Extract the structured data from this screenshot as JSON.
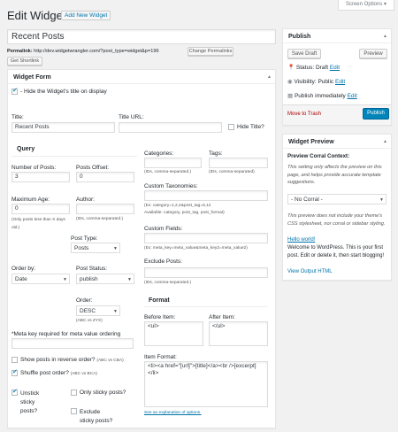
{
  "page": {
    "title": "Edit Widget",
    "add_new": "Add New Widget",
    "screen_options": "Screen Options",
    "post_title": "Recent Posts",
    "permalink_label": "Permalink:",
    "permalink_url": "http://dev.widgetwrangler.com/?post_type=widget&p=196",
    "change_permalinks": "Change Permalinks",
    "get_shortlink": "Get Shortlink"
  },
  "form": {
    "header": "Widget Form",
    "hide_title_label": "- Hide the Widget's title on display",
    "title_label": "Title:",
    "title_value": "Recent Posts",
    "title_url_label": "Title URL:",
    "title_url_value": "",
    "hide_title_q": "Hide Title?",
    "query_header": "Query",
    "num_posts_label": "Number of Posts:",
    "num_posts_value": "3",
    "offset_label": "Posts Offset:",
    "offset_value": "0",
    "max_age_label": "Maximum Age:",
    "max_age_value": "0",
    "max_age_help": "(Only posts less than X days old.)",
    "author_label": "Author:",
    "author_value": "",
    "author_help": "(IDs, comma-separated.)",
    "post_type_label": "Post Type:",
    "post_type_value": "Posts",
    "order_by_label": "Order by:",
    "order_by_value": "Date",
    "post_status_label": "Post Status:",
    "post_status_value": "publish",
    "order_label": "Order:",
    "order_value": "DESC",
    "order_help": "(ABC vs ZYX)",
    "meta_key_label": "*Meta key required for meta value ordering",
    "meta_key_value": "",
    "reverse_label": "Show posts in reverse order?",
    "reverse_help": "(ABC vs CBA)",
    "shuffle_label": "Shuffle post order?",
    "shuffle_help": "(ABC vs BCA)",
    "unstick_label": "Unstick sticky posts?",
    "only_sticky_label": "Only sticky posts?",
    "exclude_sticky_label": "Exclude sticky posts?",
    "categories_label": "Categories:",
    "categories_help": "(IDs, comma-separated.)",
    "tags_label": "Tags:",
    "tags_help": "(IDs, comma-separated)",
    "custom_tax_label": "Custom Taxonomies:",
    "custom_tax_help": "(Ex: category=1,2,4&post_tag=6,12",
    "custom_tax_avail": "Available: category, post_tag, post_format)",
    "custom_fields_label": "Custom Fields:",
    "custom_fields_help": "(Ex: meta_key=meta_value&meta_key2=meta_value2)",
    "exclude_posts_label": "Exclude Posts:",
    "exclude_posts_help": "(IDs, comma-separated.)",
    "format_header": "Format",
    "before_item_label": "Before Item:",
    "before_item_value": "<ul>",
    "after_item_label": "After Item:",
    "after_item_value": "</ul>",
    "item_format_label": "Item Format:",
    "item_format_value": "<li><a href=\"[url]\">[title]</a><br />[excerpt]</li>",
    "see_options": "See an explanation of options."
  },
  "publish": {
    "header": "Publish",
    "save_draft": "Save Draft",
    "preview": "Preview",
    "status_label": "Status: Draft",
    "visibility_label": "Visibility: Public",
    "publish_time": "Publish immediately",
    "edit": "Edit",
    "trash": "Move to Trash",
    "publish_button": "Publish",
    "accent": "#0085ba"
  },
  "preview": {
    "header": "Widget Preview",
    "context_label": "Preview Corral Context:",
    "context_help": "This setting only affects the preview on this page, and helps provide accurate template suggestions.",
    "select_value": "- No Corral -",
    "note": "This preview does not include your theme's CSS stylesheet, nor corral or sidebar styling.",
    "hello_link": "Hello world!",
    "hello_text": "Welcome to WordPress. This is your first post. Edit or delete it, then start blogging!",
    "view_output": "View Output HTML"
  }
}
